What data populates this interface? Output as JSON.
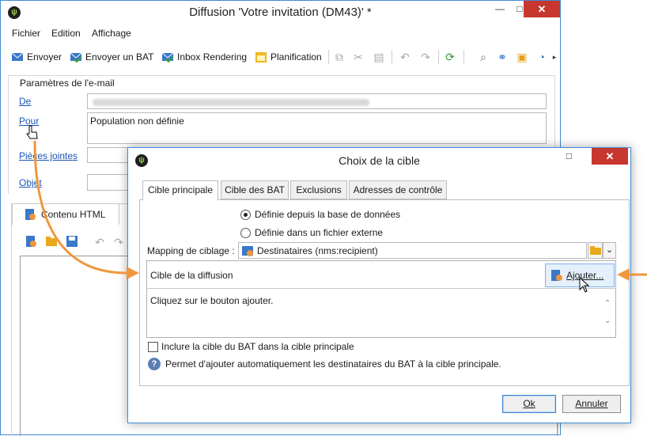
{
  "main_window": {
    "title": "Diffusion 'Votre invitation (DM43)' *",
    "controls": {
      "minimize": "—",
      "maximize": "□",
      "close": "✕"
    }
  },
  "menu": [
    "Fichier",
    "Edition",
    "Affichage"
  ],
  "toolbar": {
    "send": "Envoyer",
    "send_proof": "Envoyer un BAT",
    "inbox_rendering": "Inbox Rendering",
    "planning": "Planification"
  },
  "email_params": {
    "legend": "Paramètres de l'e-mail",
    "from_label": "De",
    "to_label": "Pour",
    "to_value": "Population non définie",
    "attachments_label": "Pièces jointes",
    "subject_label": "Objet"
  },
  "content_tab": {
    "label": "Contenu HTML"
  },
  "dialog": {
    "title": "Choix de la cible",
    "tabs": [
      "Cible principale",
      "Cible des BAT",
      "Exclusions",
      "Adresses de contrôle"
    ],
    "radio_db": "Définie depuis la base de données",
    "radio_file": "Définie dans un fichier externe",
    "mapping_label": "Mapping de ciblage :",
    "mapping_value": "Destinataires (nms:recipient)",
    "target_label": "Cible de la diffusion",
    "add_button": "Ajouter...",
    "target_hint": "Cliquez sur le bouton ajouter.",
    "include_proof_label": "Inclure la cible du BAT dans la cible principale",
    "info_text": "Permet d'ajouter automatiquement les destinataires du BAT à la cible principale.",
    "ok": "Ok",
    "cancel": "Annuler"
  },
  "colors": {
    "accent": "#3f8bd6",
    "link": "#1a55b8",
    "callout_arrow": "#f0963c",
    "close": "#c7372f"
  }
}
